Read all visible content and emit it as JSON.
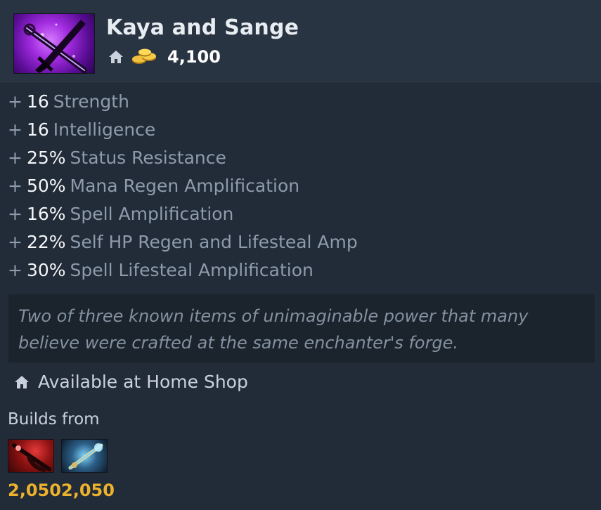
{
  "item": {
    "name": "Kaya and Sange",
    "cost": "4,100",
    "icon": "kaya-and-sange-icon"
  },
  "attributes": [
    {
      "sign": "+",
      "value": "16",
      "label": "Strength"
    },
    {
      "sign": "+",
      "value": "16",
      "label": "Intelligence"
    },
    {
      "sign": "+",
      "value": "25%",
      "label": "Status Resistance"
    },
    {
      "sign": "+",
      "value": "50%",
      "label": "Mana Regen Amplification"
    },
    {
      "sign": "+",
      "value": "16%",
      "label": "Spell Amplification"
    },
    {
      "sign": "+",
      "value": "22%",
      "label": "Self HP Regen and Lifesteal Amp"
    },
    {
      "sign": "+",
      "value": "30%",
      "label": "Spell Lifesteal Amplification"
    }
  ],
  "lore": {
    "line1": "Two of three known items of unimaginable power that many",
    "line2": "believe were crafted at the same enchanter's forge."
  },
  "availability": {
    "text": "Available at Home Shop",
    "icon": "home-icon"
  },
  "builds_from": {
    "label": "Builds from",
    "components": [
      {
        "icon": "sange-icon",
        "cost": "2,050"
      },
      {
        "icon": "kaya-icon",
        "cost": "2,050"
      }
    ]
  },
  "colors": {
    "background": "#222c38",
    "header": "#293442",
    "gold": "#ecb22e",
    "muted_text": "#8d9bab"
  }
}
